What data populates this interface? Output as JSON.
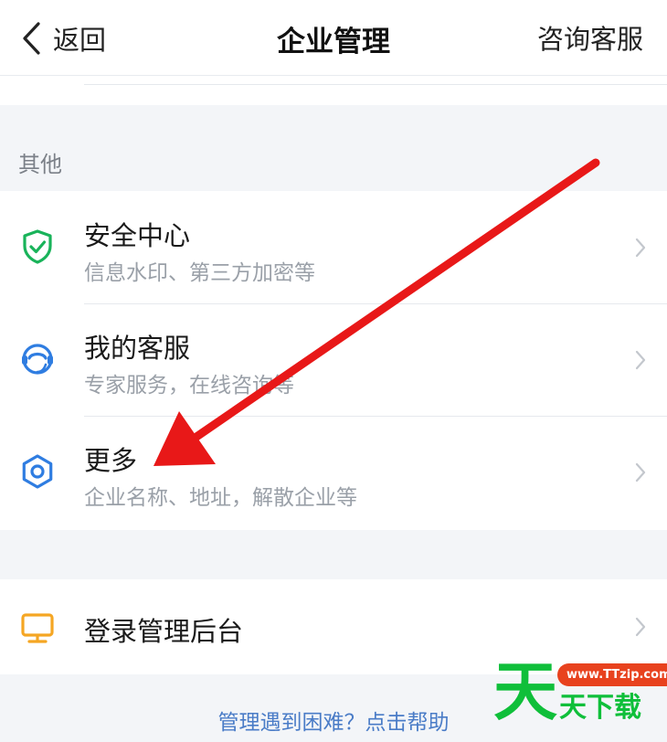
{
  "header": {
    "back_label": "返回",
    "title": "企业管理",
    "consult_label": "咨询客服"
  },
  "section_other": {
    "label": "其他",
    "items": [
      {
        "title": "安全中心",
        "subtitle": "信息水印、第三方加密等",
        "icon": "shield-check-icon"
      },
      {
        "title": "我的客服",
        "subtitle": "专家服务，在线咨询等",
        "icon": "customer-service-icon"
      },
      {
        "title": "更多",
        "subtitle": "企业名称、地址，解散企业等",
        "icon": "gear-icon"
      }
    ]
  },
  "admin": {
    "title": "登录管理后台",
    "icon": "monitor-icon"
  },
  "help_link": "管理遇到困难？点击帮助",
  "watermark": {
    "big": "天",
    "url": "www.TTzip.com",
    "sub": "天下载"
  },
  "colors": {
    "background": "#f3f5f8",
    "shield_green": "#19b35a",
    "icon_blue": "#2f7de1",
    "monitor_orange": "#f5a623",
    "arrow_red": "#e81818",
    "link_blue": "#4a7cc7"
  }
}
